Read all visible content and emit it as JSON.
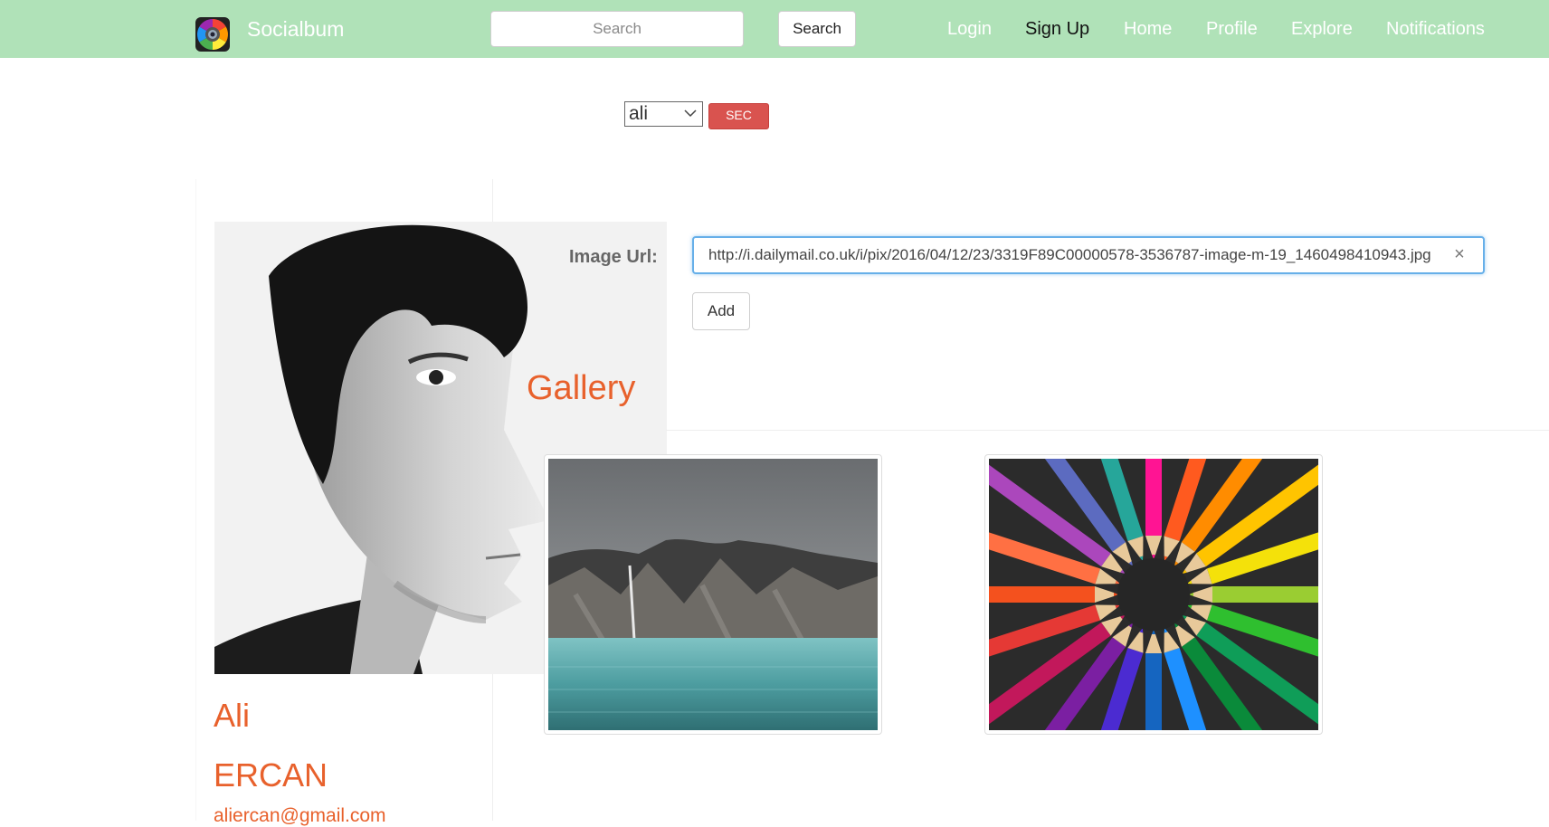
{
  "navbar": {
    "brand": "Socialbum",
    "search_placeholder": "Search",
    "search_button": "Search",
    "links": {
      "login": "Login",
      "signup": "Sign Up",
      "home": "Home",
      "profile": "Profile",
      "explore": "Explore",
      "notifications": "Notifications"
    },
    "icons": {
      "logo": "camera-aperture-logo"
    }
  },
  "user_switcher": {
    "selected": "ali",
    "button": "SEC"
  },
  "profile": {
    "first_name": "Ali",
    "last_name": "ERCAN",
    "email": "aliercan@gmail.com"
  },
  "gallery": {
    "title": "Gallery",
    "url_label": "Image Url:",
    "url_value": "http://i.dailymail.co.uk/i/pix/2016/04/12/23/3319F89C00000578-3536787-image-m-19_1460498410943.jpg",
    "add_button": "Add",
    "images": [
      {
        "subject": "mountain-lake-photo"
      },
      {
        "subject": "colored-pencils-circle-photo"
      }
    ]
  },
  "colors": {
    "navbar": "#b0e2b8",
    "accent": "#e8612c",
    "danger": "#d9534f",
    "focus": "#66afe9"
  }
}
